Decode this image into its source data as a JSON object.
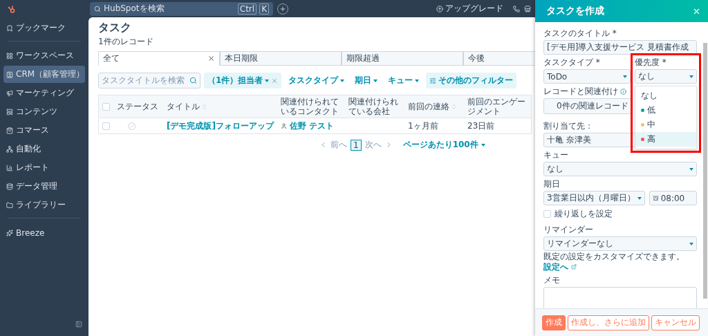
{
  "topbar": {
    "search": {
      "placeholder": "HubSpotを検索"
    },
    "shortcut": [
      "Ctrl",
      "K"
    ],
    "upgrade": "アップグレード"
  },
  "sidebar": {
    "items": [
      {
        "label": "ブックマーク",
        "selected": false
      },
      {
        "label": "ワークスペース",
        "selected": false
      },
      {
        "label": "CRM（顧客管理）",
        "selected": true
      },
      {
        "label": "マーケティング",
        "selected": false
      },
      {
        "label": "コンテンツ",
        "selected": false
      },
      {
        "label": "コマース",
        "selected": false
      },
      {
        "label": "自動化",
        "selected": false
      },
      {
        "label": "レポート",
        "selected": false
      },
      {
        "label": "データ管理",
        "selected": false
      },
      {
        "label": "ライブラリー",
        "selected": false
      }
    ],
    "breeze": "Breeze"
  },
  "main": {
    "title": "タスク",
    "subtitle": "1件のレコード",
    "tabs": [
      {
        "label": "全て",
        "selected": true
      },
      {
        "label": "本日期限",
        "selected": false
      },
      {
        "label": "期限超過",
        "selected": false
      },
      {
        "label": "今後",
        "selected": false
      }
    ],
    "search": {
      "placeholder": "タスクタイトルを検索"
    },
    "filters": [
      {
        "label": "（1件）担当者",
        "active": true
      },
      {
        "label": "タスクタイプ",
        "active": false
      },
      {
        "label": "期日",
        "active": false
      },
      {
        "label": "キュー",
        "active": false
      }
    ],
    "more_filters": "その他のフィルター",
    "table": {
      "all_checked": false,
      "columns": [
        {
          "label": "ステータス",
          "sortable": false
        },
        {
          "label": "タイトル",
          "sortable": true
        },
        {
          "label": "関連付けられているコンタクト",
          "sortable": false
        },
        {
          "label": "関連付けられている会社",
          "sortable": false
        },
        {
          "label": "前回の連絡",
          "sortable": true
        },
        {
          "label": "前回のエンゲージメント",
          "sortable": false
        }
      ],
      "rows": [
        {
          "checked": false,
          "title": "[デモ完成版]フォローアップ",
          "contact": "佐野 テスト",
          "company": "",
          "last_contact": "1ヶ月前",
          "last_engagement": "23日前"
        }
      ]
    },
    "pagination": {
      "prev": "前へ",
      "page": "1",
      "next": "次へ",
      "per_page": "ページあたり100件"
    }
  },
  "drawer": {
    "title": "タスクを作成",
    "task_title": {
      "label": "タスクのタイトル *",
      "value": "[デモ用]導入支援サービス 見積書作成"
    },
    "task_type": {
      "label": "タスクタイプ *",
      "value": "ToDo"
    },
    "priority": {
      "label": "優先度 *",
      "value": "なし",
      "options": [
        {
          "label": "なし",
          "highlighted": false
        },
        {
          "label": "低",
          "color": "#00a4a6",
          "highlighted": false
        },
        {
          "label": "中",
          "color": "#f5c26b",
          "highlighted": false
        },
        {
          "label": "高",
          "color": "#f2545b",
          "highlighted": true
        }
      ]
    },
    "associate": {
      "label": "レコードと関連付け",
      "value": "0件の関連レコード"
    },
    "assignee": {
      "label": "割り当て先：",
      "value": "十亀 奈津美"
    },
    "queue": {
      "label": "キュー",
      "value": "なし"
    },
    "due": {
      "label": "期日",
      "value": "3営業日以内（月曜日）",
      "time": "08:00"
    },
    "repeat": {
      "label": "繰り返しを設定",
      "checked": false
    },
    "reminder": {
      "label": "リマインダー",
      "value": "リマインダーなし"
    },
    "hint": "既定の設定をカスタマイズできます。",
    "hint_link": "設定へ",
    "memo": {
      "label": "メモ"
    },
    "buttons": [
      {
        "label": "作成",
        "kind": "primary"
      },
      {
        "label": "作成し、さらに追加",
        "kind": "secondary"
      },
      {
        "label": "キャンセル",
        "kind": "secondary"
      }
    ]
  }
}
